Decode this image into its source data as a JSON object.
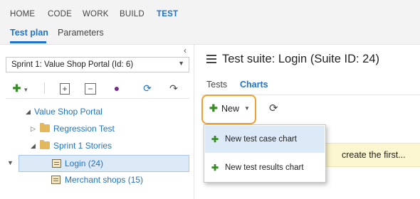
{
  "topnav": {
    "tabs": [
      "HOME",
      "CODE",
      "WORK",
      "BUILD",
      "TEST"
    ]
  },
  "subnav": {
    "tabs": [
      "Test plan",
      "Parameters"
    ]
  },
  "plan_select": {
    "value": "Sprint 1: Value Shop Portal (Id: 6)"
  },
  "tree": {
    "root": "Value Shop Portal",
    "items": [
      "Regression Test",
      "Sprint 1 Stories",
      "Login (24)",
      "Merchant shops (15)"
    ]
  },
  "suite": {
    "title": "Test suite: Login (Suite ID: 24)"
  },
  "right_tabs": [
    "Tests",
    "Charts"
  ],
  "new_button": {
    "label": "New"
  },
  "menu": {
    "items": [
      "New test case chart",
      "New test results chart"
    ]
  },
  "banner": {
    "text": "create the first..."
  },
  "colors": {
    "accent": "#1e73c8",
    "highlight_outline": "#f0a030",
    "add_green": "#3a8a2a"
  }
}
